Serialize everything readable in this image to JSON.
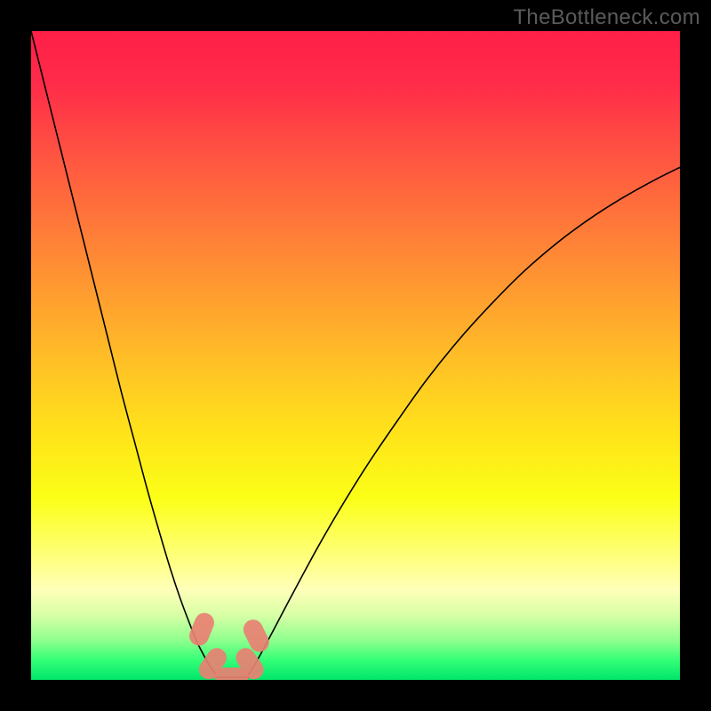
{
  "watermark": "TheBottleneck.com",
  "chart_data": {
    "type": "line",
    "title": "",
    "xlabel": "",
    "ylabel": "",
    "xlim": [
      0,
      100
    ],
    "ylim": [
      0,
      100
    ],
    "grid": false,
    "background_gradient": {
      "stops": [
        {
          "offset": 0.0,
          "color": "#ff1f47"
        },
        {
          "offset": 0.08,
          "color": "#ff2b49"
        },
        {
          "offset": 0.2,
          "color": "#ff5741"
        },
        {
          "offset": 0.35,
          "color": "#ff8a35"
        },
        {
          "offset": 0.5,
          "color": "#ffbd27"
        },
        {
          "offset": 0.62,
          "color": "#ffe31a"
        },
        {
          "offset": 0.72,
          "color": "#fbff17"
        },
        {
          "offset": 0.82,
          "color": "#ffff87"
        },
        {
          "offset": 0.86,
          "color": "#ffffb9"
        },
        {
          "offset": 0.9,
          "color": "#d8ffa6"
        },
        {
          "offset": 0.94,
          "color": "#8cff8c"
        },
        {
          "offset": 0.97,
          "color": "#33ff77"
        },
        {
          "offset": 1.0,
          "color": "#00e56a"
        }
      ]
    },
    "series": [
      {
        "name": "curve-left",
        "color": "#000000",
        "width": 1.6,
        "x": [
          0.0,
          2.0,
          4.0,
          6.0,
          8.0,
          10.0,
          12.0,
          14.0,
          16.0,
          18.0,
          20.0,
          21.5,
          23.0,
          24.5,
          25.5,
          26.5,
          27.5,
          28.5
        ],
        "y": [
          100.0,
          92.0,
          84.0,
          76.0,
          68.0,
          60.0,
          52.0,
          44.0,
          36.5,
          29.0,
          22.0,
          17.0,
          12.5,
          8.5,
          6.0,
          4.0,
          2.2,
          0.8
        ]
      },
      {
        "name": "curve-right",
        "color": "#000000",
        "width": 1.6,
        "x": [
          33.5,
          34.5,
          35.5,
          37.0,
          39.0,
          41.5,
          44.5,
          48.0,
          52.0,
          56.5,
          61.0,
          66.0,
          71.0,
          76.0,
          81.0,
          86.0,
          91.0,
          96.0,
          100.0
        ],
        "y": [
          0.8,
          2.4,
          4.2,
          7.0,
          10.8,
          15.5,
          21.0,
          27.0,
          33.4,
          40.0,
          46.3,
          52.5,
          58.0,
          63.0,
          67.3,
          71.0,
          74.2,
          77.0,
          79.0
        ]
      },
      {
        "name": "baseline",
        "color": "#000000",
        "width": 1.6,
        "x": [
          28.5,
          33.5
        ],
        "y": [
          0.4,
          0.4
        ]
      }
    ],
    "markers": [
      {
        "x": 26.3,
        "y": 7.8,
        "angle": -68
      },
      {
        "x": 28.0,
        "y": 2.5,
        "angle": -55
      },
      {
        "x": 33.7,
        "y": 2.5,
        "angle": 55
      },
      {
        "x": 34.7,
        "y": 6.8,
        "angle": 64
      },
      {
        "x": 30.9,
        "y": 0.4,
        "angle": 0
      }
    ],
    "marker_style": {
      "color": "#e98073",
      "rx": 5.2,
      "ry": 3.0,
      "corner": 3.0
    }
  }
}
